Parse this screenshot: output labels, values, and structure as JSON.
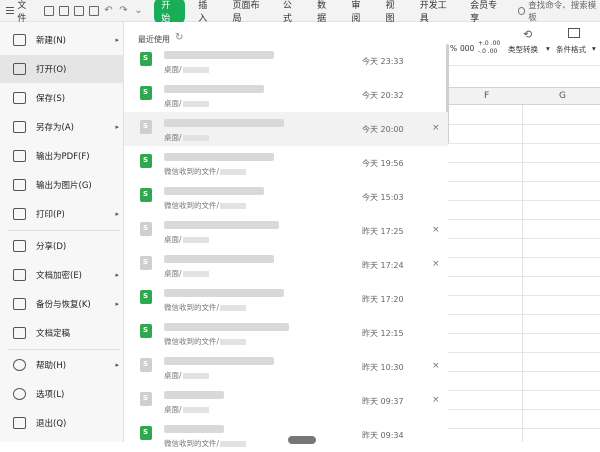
{
  "topbar": {
    "file_label": "文件",
    "start_tab": "开始",
    "tabs": [
      "插入",
      "页面布局",
      "公式",
      "数据",
      "审阅",
      "视图",
      "开发工具",
      "会员专享"
    ],
    "search_placeholder": "查找命令、搜索模板"
  },
  "ribbon": {
    "percent": "%",
    "zeros": "000",
    "dec1": "+.0 .00",
    "dec2": "-.0 .00",
    "type_convert": "类型转换",
    "cond_format": "条件格式",
    "dropdown": "▾"
  },
  "sheet": {
    "columns": [
      "F",
      "G"
    ]
  },
  "menu": {
    "items": [
      {
        "label": "新建(N)",
        "arrow": "▸"
      },
      {
        "label": "打开(O)"
      },
      {
        "label": "保存(S)"
      },
      {
        "label": "另存为(A)",
        "arrow": "▸"
      },
      {
        "label": "输出为PDF(F)"
      },
      {
        "label": "输出为图片(G)"
      },
      {
        "label": "打印(P)",
        "arrow": "▸"
      },
      {
        "label": "分享(D)"
      },
      {
        "label": "文档加密(E)",
        "arrow": "▸"
      },
      {
        "label": "备份与恢复(K)",
        "arrow": "▸"
      },
      {
        "label": "文档定稿"
      },
      {
        "label": "帮助(H)",
        "arrow": "▸"
      },
      {
        "label": "选项(L)"
      },
      {
        "label": "退出(Q)"
      }
    ]
  },
  "recent": {
    "title": "最近使用",
    "files": [
      {
        "path": "桌面/",
        "time": "今天 23:33",
        "icon": "green"
      },
      {
        "path": "桌面/",
        "time": "今天 20:32",
        "icon": "green"
      },
      {
        "path": "桌面/",
        "time": "今天 20:00",
        "icon": "gray",
        "close": "×"
      },
      {
        "path": "微信收到的文件/",
        "time": "今天 19:56",
        "icon": "green"
      },
      {
        "path": "微信收到的文件/",
        "time": "今天 15:03",
        "icon": "green"
      },
      {
        "path": "桌面/",
        "time": "昨天 17:25",
        "icon": "gray",
        "close": "×"
      },
      {
        "path": "桌面/",
        "time": "昨天 17:24",
        "icon": "gray",
        "close": "×"
      },
      {
        "path": "微信收到的文件/",
        "time": "昨天 17:20",
        "icon": "green"
      },
      {
        "path": "微信收到的文件/",
        "time": "昨天 12:15",
        "icon": "green"
      },
      {
        "path": "桌面/",
        "time": "昨天 10:30",
        "icon": "gray",
        "close": "×"
      },
      {
        "path": "桌面/",
        "time": "昨天 09:37",
        "icon": "gray",
        "close": "×"
      },
      {
        "path": "微信收到的文件/",
        "time": "昨天 09:34",
        "icon": "green"
      }
    ]
  }
}
